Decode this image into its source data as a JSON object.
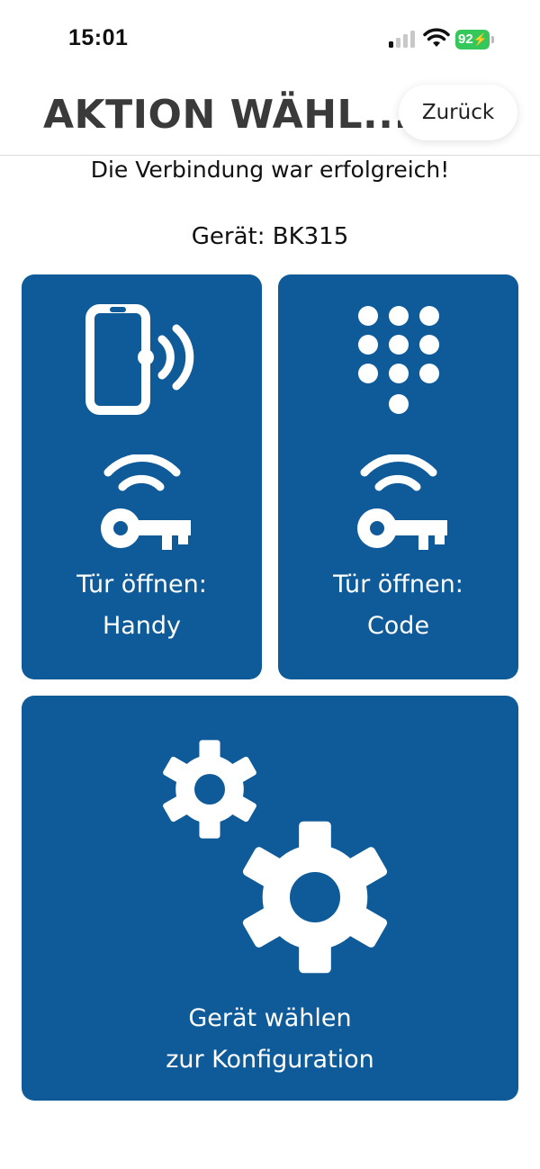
{
  "status_bar": {
    "time": "15:01",
    "battery": "92",
    "battery_color": "#34c759",
    "icons": [
      "signal-icon",
      "wifi-icon",
      "battery-charging-icon"
    ]
  },
  "header": {
    "title": "AKTION WÄHL...",
    "back_label": "Zurück"
  },
  "main": {
    "connection_message": "Die Verbindung war erfolgreich!",
    "device": "Gerät: BK315"
  },
  "tiles": {
    "phone": {
      "line1": "Tür öffnen:",
      "line2": "Handy",
      "icons": [
        "phone-nfc-icon",
        "wireless-key-icon"
      ]
    },
    "code": {
      "line1": "Tür öffnen:",
      "line2": "Code",
      "icons": [
        "keypad-icon",
        "wireless-key-icon"
      ]
    },
    "config": {
      "line1": "Gerät wählen",
      "line2": "zur Konfiguration",
      "icons": [
        "gears-icon"
      ]
    }
  },
  "colors": {
    "tile_background": "#0f5b9a",
    "title_color": "#3a3a3a"
  }
}
